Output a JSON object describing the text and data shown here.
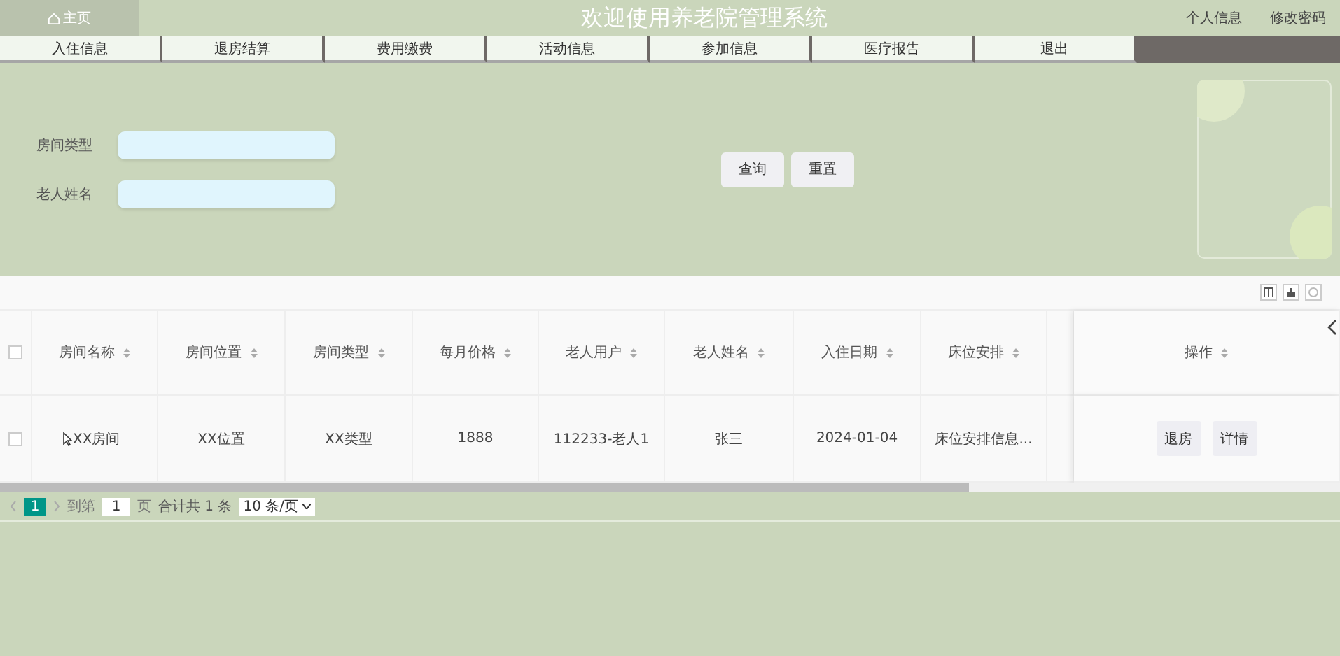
{
  "header": {
    "home": "主页",
    "title": "欢迎使用养老院管理系统",
    "links": [
      "个人信息",
      "修改密码"
    ]
  },
  "nav": [
    "入住信息",
    "退房结算",
    "费用缴费",
    "活动信息",
    "参加信息",
    "医疗报告",
    "退出"
  ],
  "search": {
    "fields": [
      {
        "label": "房间类型"
      },
      {
        "label": "老人姓名"
      }
    ],
    "buttons": [
      "查询",
      "重置"
    ]
  },
  "table": {
    "all_checked": false,
    "columns": [
      "房间名称",
      "房间位置",
      "房间类型",
      "每月价格",
      "老人用户",
      "老人姓名",
      "入住日期",
      "床位安排",
      "操作"
    ],
    "rows": [
      {
        "checked": false,
        "cells": [
          "XX房间",
          "XX位置",
          "XX类型",
          "1888",
          "112233-老人1",
          "张三",
          "2024-01-04",
          "床位安排信息..."
        ],
        "actions": [
          "退房",
          "详情"
        ]
      }
    ]
  },
  "pagination": {
    "pages": [
      {
        "label": "1",
        "selected": true
      }
    ],
    "goto_prefix": "到第",
    "goto_value": "1",
    "goto_suffix": "页",
    "total": "合计共 1 条",
    "page_size": "10 条/页"
  }
}
